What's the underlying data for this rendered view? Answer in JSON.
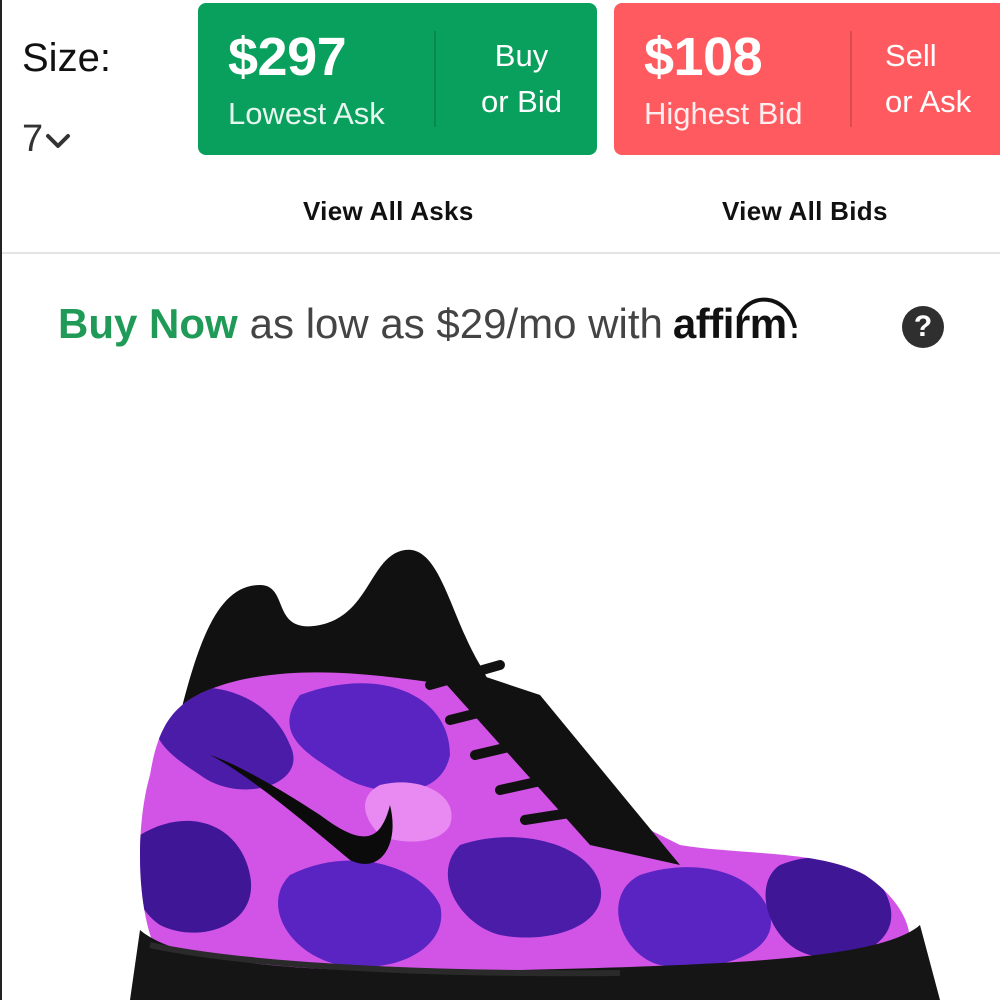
{
  "size": {
    "label": "Size:",
    "value": "7",
    "chevron_icon": "chevron-down-icon"
  },
  "ask": {
    "price": "$297",
    "label": "Lowest Ask",
    "action_line1": "Buy",
    "action_line2": "or Bid",
    "color": "#08a05c"
  },
  "bid": {
    "price": "$108",
    "label": "Highest Bid",
    "action_line1": "Sell",
    "action_line2": "or Ask",
    "color": "#ff5a5f"
  },
  "links": {
    "view_asks": "View All Asks",
    "view_bids": "View All Bids"
  },
  "promo": {
    "buy_now": "Buy Now",
    "text": "as low as $29/mo with",
    "brand": "affirm",
    "brand_suffix": ".",
    "help_icon": "question-icon",
    "help_glyph": "?",
    "accent": "#1f9a57"
  },
  "product": {
    "image": "purple-camo-sneaker"
  }
}
